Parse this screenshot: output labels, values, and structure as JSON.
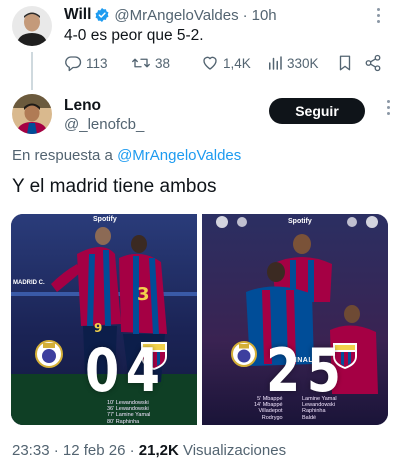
{
  "parent_tweet": {
    "name": "Will",
    "handle": "@MrAngeloValdes",
    "separator": "·",
    "time": "10h",
    "text": "4-0 es peor que 5-2.",
    "replies": "113",
    "reposts": "38",
    "likes": "1,4K",
    "views": "330K",
    "verified_color": "#1d9bf0"
  },
  "reply_tweet": {
    "name": "Leno",
    "handle": "@_lenofcb_",
    "follow_label": "Seguir",
    "reply_prefix": "En respuesta a",
    "reply_mention": "@MrAngeloValdes",
    "text": "Y el madrid tiene ambos",
    "media": [
      {
        "sponsor": "Spotify",
        "score_home": "0",
        "score_away": "4",
        "banner": "MADRID C.",
        "scorers": "10' Lewandowski\n36' Lewandowski\n77' Lamine Yamal\n80' Raphinha"
      },
      {
        "sponsor": "Spotify",
        "score_home": "2",
        "score_away": "5",
        "final_label": "FINAL",
        "scorers_home": "5' Mbappé\n14' Mbappé\nVilladepot\nRodrygo",
        "scorers_away": "Lamine Yamal\nLewandowski\nRaphinha\nBaldé"
      }
    ],
    "timestamp": "23:33 · 12 feb 26 ·",
    "views_count": "21,2K",
    "views_label": "Visualizaciones"
  },
  "colors": {
    "accent": "#1d9bf0",
    "secondary_text": "#536471",
    "follow_button": "#0f1419",
    "barca_red": "#a50044",
    "barca_blue": "#004d98"
  }
}
